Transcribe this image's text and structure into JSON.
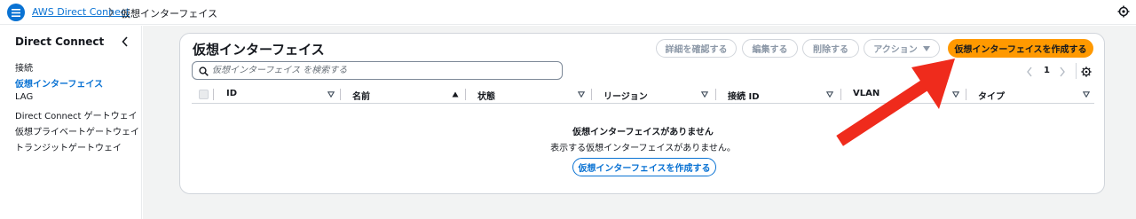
{
  "breadcrumb": {
    "service": "AWS Direct Connect",
    "current": "仮想インターフェイス"
  },
  "sidebar": {
    "title": "Direct Connect",
    "items": [
      {
        "label": "接続",
        "active": false
      },
      {
        "label": "仮想インターフェイス",
        "active": true
      },
      {
        "label": "LAG",
        "active": false
      },
      {
        "label": "Direct Connect ゲートウェイ",
        "active": false
      },
      {
        "label": "仮想プライベートゲートウェイ",
        "active": false
      },
      {
        "label": "トランジットゲートウェイ",
        "active": false
      }
    ]
  },
  "panel": {
    "title": "仮想インターフェイス",
    "buttons": {
      "details": "詳細を確認する",
      "edit": "編集する",
      "delete": "削除する",
      "actions": "アクション",
      "create": "仮想インターフェイスを作成する"
    },
    "search": {
      "placeholder": "仮想インターフェイス を検索する",
      "value": ""
    },
    "pagination": {
      "current_page": "1"
    },
    "columns": [
      "ID",
      "名前",
      "状態",
      "リージョン",
      "接続 ID",
      "VLAN",
      "タイプ"
    ],
    "empty": {
      "title": "仮想インターフェイスがありません",
      "description": "表示する仮想インターフェイスがありません。",
      "button": "仮想インターフェイスを作成する"
    }
  },
  "colors": {
    "accent": "#0972d3",
    "primary_button": "#ff9900",
    "annotation_arrow": "#ef2b1c"
  },
  "icons": [
    "menu-icon",
    "chevron-right-icon",
    "settings-icon",
    "close-sidebar-icon",
    "search-icon",
    "caret-down-icon",
    "chevron-left-icon",
    "sort-ascending-icon",
    "sort-icon",
    "red-arrow-annotation"
  ]
}
